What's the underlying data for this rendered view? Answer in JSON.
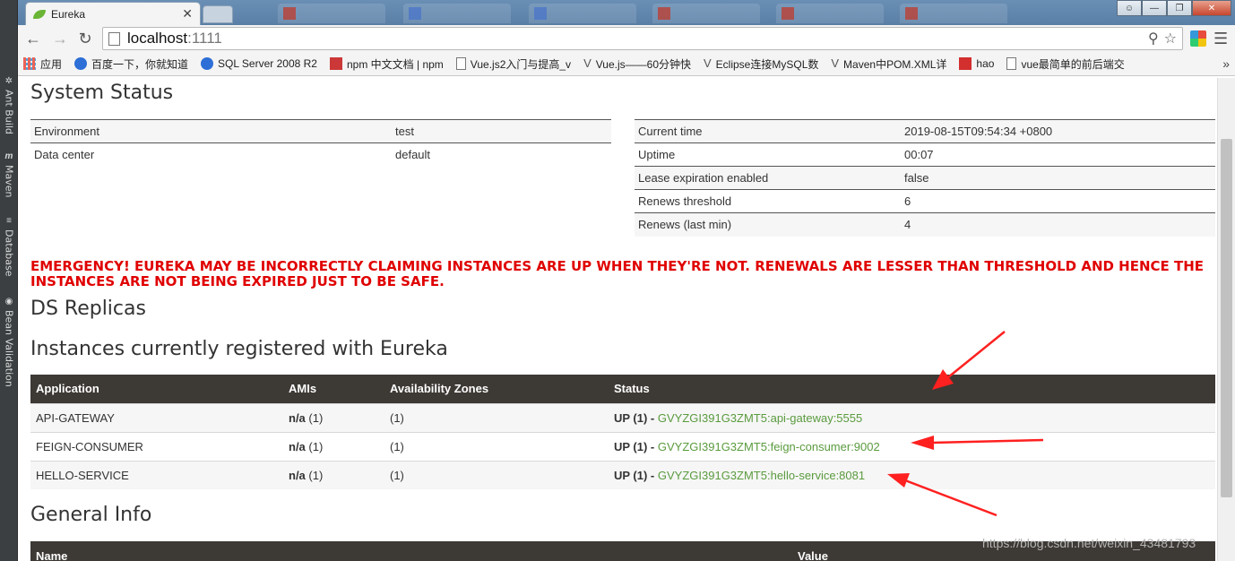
{
  "ide": {
    "tabs": [
      {
        "icon": "ant-icon",
        "label": "Ant Build"
      },
      {
        "icon": "maven-icon",
        "label": "Maven"
      },
      {
        "icon": "database-icon",
        "label": "Database"
      },
      {
        "icon": "bean-icon",
        "label": "Bean Validation"
      }
    ]
  },
  "browser": {
    "tab_title": "Eureka",
    "url_host": "localhost",
    "url_port": ":1111",
    "bookmarks": [
      {
        "icon": "apps-icon",
        "label": "应用"
      },
      {
        "icon": "baidu-icon",
        "label": "百度一下，你就知道"
      },
      {
        "icon": "baidu-icon",
        "label": "SQL Server 2008 R2"
      },
      {
        "icon": "npm-icon",
        "label": "npm 中文文档 | npm"
      },
      {
        "icon": "page-icon",
        "label": "Vue.js2入门与提高_v"
      },
      {
        "icon": "vue-icon",
        "label": "Vue.js——60分钟快"
      },
      {
        "icon": "vue-icon",
        "label": "Eclipse连接MySQL数"
      },
      {
        "icon": "vue-icon",
        "label": "Maven中POM.XML详"
      },
      {
        "icon": "csdn-icon",
        "label": "hao"
      },
      {
        "icon": "page-icon",
        "label": "vue最简单的前后端交"
      }
    ],
    "more_bookmarks": "»"
  },
  "system_status": {
    "title": "System Status",
    "left": [
      {
        "key": "Environment",
        "value": "test"
      },
      {
        "key": "Data center",
        "value": "default"
      }
    ],
    "right": [
      {
        "key": "Current time",
        "value": "2019-08-15T09:54:34 +0800"
      },
      {
        "key": "Uptime",
        "value": "00:07"
      },
      {
        "key": "Lease expiration enabled",
        "value": "false"
      },
      {
        "key": "Renews threshold",
        "value": "6"
      },
      {
        "key": "Renews (last min)",
        "value": "4"
      }
    ]
  },
  "emergency": "EMERGENCY! EUREKA MAY BE INCORRECTLY CLAIMING INSTANCES ARE UP WHEN THEY'RE NOT. RENEWALS ARE LESSER THAN THRESHOLD AND HENCE THE INSTANCES ARE NOT BEING EXPIRED JUST TO BE SAFE.",
  "ds_replicas_title": "DS Replicas",
  "instances": {
    "title": "Instances currently registered with Eureka",
    "headers": {
      "application": "Application",
      "amis": "AMIs",
      "zones": "Availability Zones",
      "status": "Status"
    },
    "rows": [
      {
        "app": "API-GATEWAY",
        "amis": "n/a",
        "amis_count": " (1)",
        "zones": "(1)",
        "status": "UP (1) - ",
        "link": "GVYZGI391G3ZMT5:api-gateway:5555"
      },
      {
        "app": "FEIGN-CONSUMER",
        "amis": "n/a",
        "amis_count": " (1)",
        "zones": "(1)",
        "status": "UP (1) - ",
        "link": "GVYZGI391G3ZMT5:feign-consumer:9002"
      },
      {
        "app": "HELLO-SERVICE",
        "amis": "n/a",
        "amis_count": " (1)",
        "zones": "(1)",
        "status": "UP (1) - ",
        "link": "GVYZGI391G3ZMT5:hello-service:8081"
      }
    ]
  },
  "general_info": {
    "title": "General Info",
    "headers": {
      "name": "Name",
      "value": "Value"
    }
  },
  "watermark": "https://blog.csdn.net/weixin_43481793",
  "colors": {
    "emergency": "#e00000",
    "link": "#5a9b3e",
    "header_bg": "#3d3935",
    "annotation_arrow": "#ff2020"
  }
}
